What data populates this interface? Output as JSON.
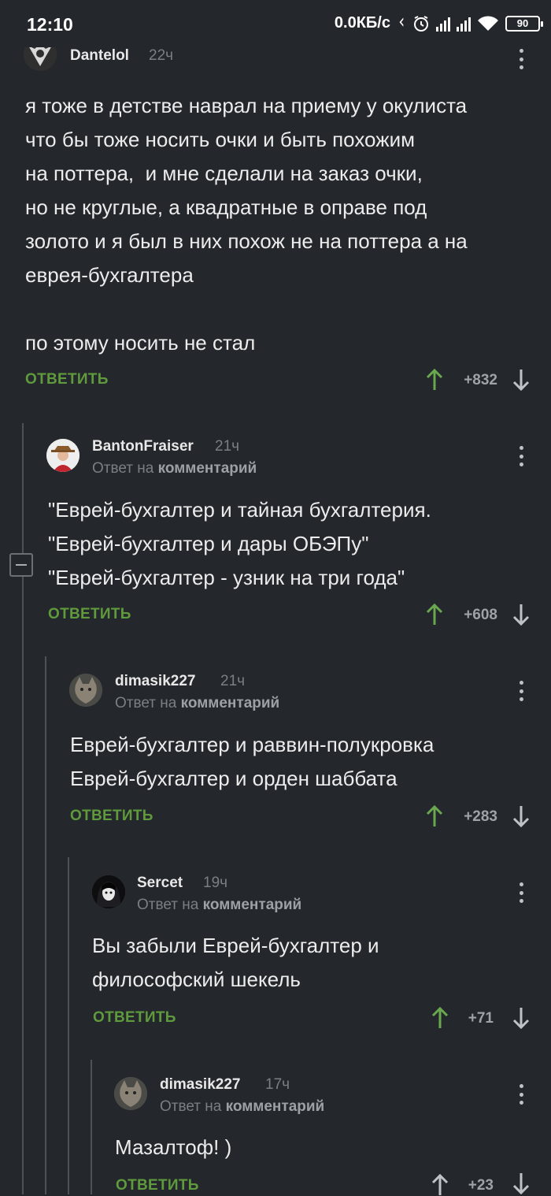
{
  "status": {
    "time": "12:10",
    "net_speed": "0.0КБ/с",
    "battery": "90"
  },
  "comments": [
    {
      "author": "Dantelol",
      "time": "22ч",
      "text": "я тоже в детстве наврал на приему у окулиста\nчто бы тоже носить очки и быть похожим\nна поттера,  и мне сделали на заказ очки,\nно не круглые, а квадратные в оправе под\nзолото и я был в них похож не на поттера а на\nеврея-бухгалтера\n\nпо этому носить не стал",
      "reply": "ОТВЕТИТЬ",
      "score": "+832"
    },
    {
      "author": "BantonFraiser",
      "time": "21ч",
      "reply_prefix": "Ответ на",
      "reply_target": "комментарий",
      "text": "\"Еврей-бухгалтер и тайная бухгалтерия.\n\"Еврей-бухгалтер и дары ОБЭПу\"\n\"Еврей-бухгалтер - узник на три года\"",
      "reply": "ОТВЕТИТЬ",
      "score": "+608"
    },
    {
      "author": "dimasik227",
      "time": "21ч",
      "reply_prefix": "Ответ на",
      "reply_target": "комментарий",
      "text": "Еврей-бухгалтер и раввин-полукровка\nЕврей-бухгалтер и орден шаббата",
      "reply": "ОТВЕТИТЬ",
      "score": "+283"
    },
    {
      "author": "Sercet",
      "time": "19ч",
      "reply_prefix": "Ответ на",
      "reply_target": "комментарий",
      "text": "Вы забыли Еврей-бухгалтер и\nфилософский шекель",
      "reply": "ОТВЕТИТЬ",
      "score": "+71"
    },
    {
      "author": "dimasik227",
      "time": "17ч",
      "reply_prefix": "Ответ на",
      "reply_target": "комментарий",
      "text": "Мазалтоф! )",
      "reply": "ОТВЕТИТЬ",
      "score": "+23"
    }
  ],
  "colors": {
    "background": "#24272b",
    "reply_green": "#5f9a3d",
    "muted": "#7b7f84"
  }
}
